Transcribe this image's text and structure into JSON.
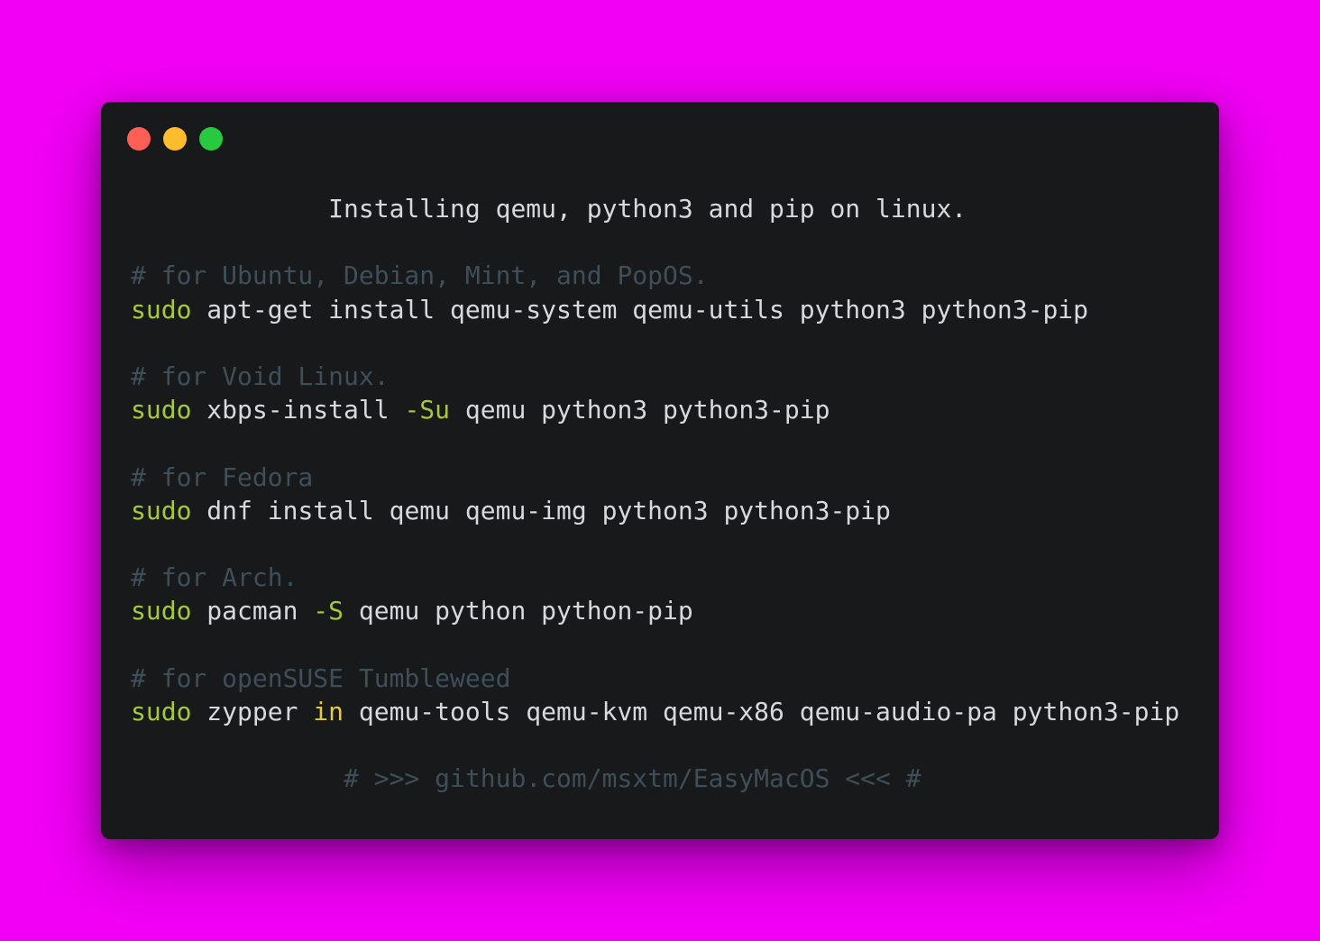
{
  "window": {
    "controls": {
      "close": "close-dot",
      "minimize": "minimize-dot",
      "zoom": "zoom-dot"
    }
  },
  "code": {
    "title": "Installing qemu, python3 and pip on linux.",
    "ubuntu": {
      "comment": "# for Ubuntu, Debian, Mint, and PopOS.",
      "sudo": "sudo",
      "rest": " apt-get install qemu-system qemu-utils python3 python3-pip"
    },
    "void": {
      "comment": "# for Void Linux.",
      "sudo": "sudo",
      "cmd": " xbps-install ",
      "flag": "-Su",
      "rest": " qemu python3 python3-pip"
    },
    "fedora": {
      "comment": "# for Fedora",
      "sudo": "sudo",
      "rest": " dnf install qemu qemu-img python3 python3-pip"
    },
    "arch": {
      "comment": "# for Arch.",
      "sudo": "sudo",
      "cmd": " pacman ",
      "flag": "-S",
      "rest": " qemu python python-pip"
    },
    "opensuse": {
      "comment": "# for openSUSE Tumbleweed",
      "sudo": "sudo",
      "cmd": " zypper ",
      "keyword": "in",
      "rest": " qemu-tools qemu-kvm qemu-x86 qemu-audio-pa python3-pip"
    },
    "footer": "# >>> github.com/msxtm/EasyMacOS <<< #"
  },
  "colors": {
    "background": "#f200f6",
    "window": "#17191a",
    "text": "#d7dadd",
    "comment": "#3e4f5a",
    "command": "#a6c93a",
    "keyword": "#e5c844",
    "close": "#ff5f56",
    "minimize": "#ffbd2e",
    "zoom": "#27c93f"
  }
}
